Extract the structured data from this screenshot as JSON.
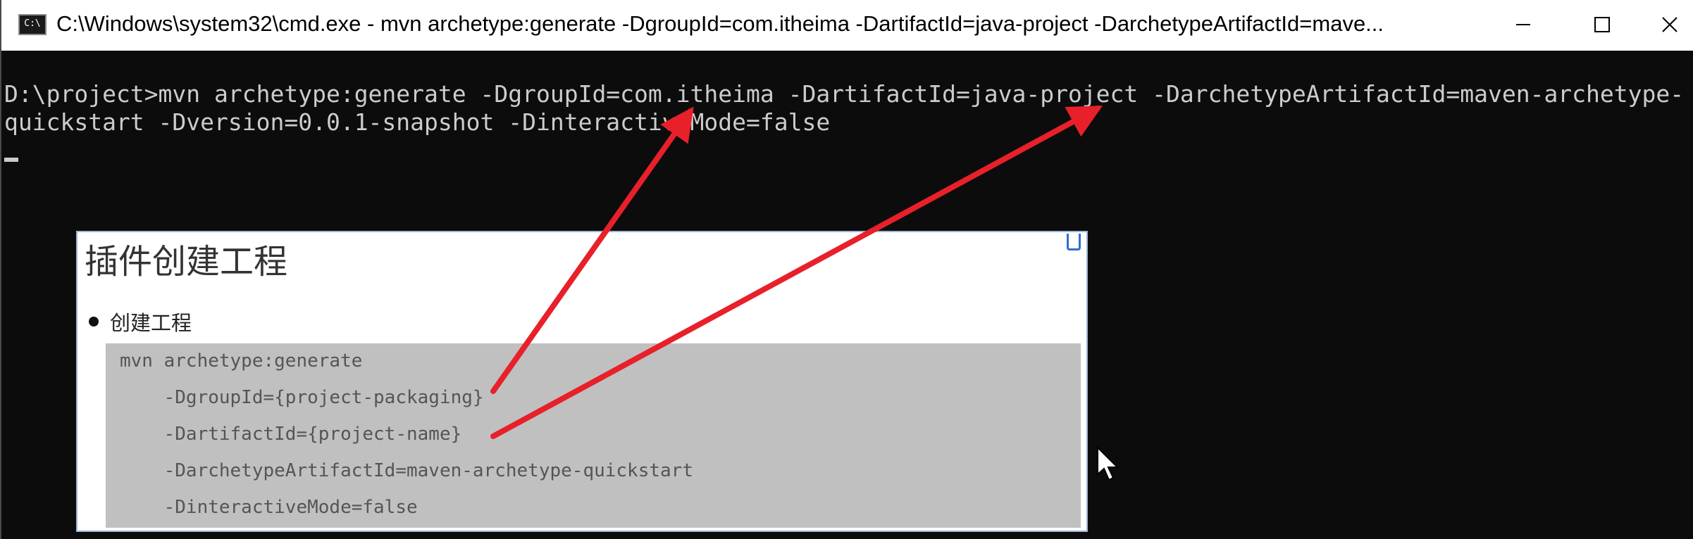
{
  "window": {
    "title": "C:\\Windows\\system32\\cmd.exe - mvn  archetype:generate -DgroupId=com.itheima -DartifactId=java-project -DarchetypeArtifactId=mave...",
    "icon_text": "C:\\",
    "controls": {
      "minimize": "minimize-icon",
      "maximize": "maximize-icon",
      "close": "close-icon"
    }
  },
  "console": {
    "lines": [
      "D:\\project>mvn archetype:generate -DgroupId=com.itheima -DartifactId=java-project -DarchetypeArtifactId=maven-archetype-",
      "quickstart -Dversion=0.0.1-snapshot -DinteractiveMode=false"
    ]
  },
  "slide": {
    "title": "插件创建工程",
    "bullet": "创建工程",
    "code": [
      "mvn archetype:generate",
      "    -DgroupId={project-packaging}",
      "    -DartifactId={project-name}",
      "    -DarchetypeArtifactId=maven-archetype-quickstart",
      "    -DinteractiveMode=false"
    ]
  },
  "colors": {
    "arrow": "#e8202a",
    "console_bg": "#0c0c0c",
    "console_text": "#cccccc",
    "code_bg": "#c0c0c0"
  }
}
